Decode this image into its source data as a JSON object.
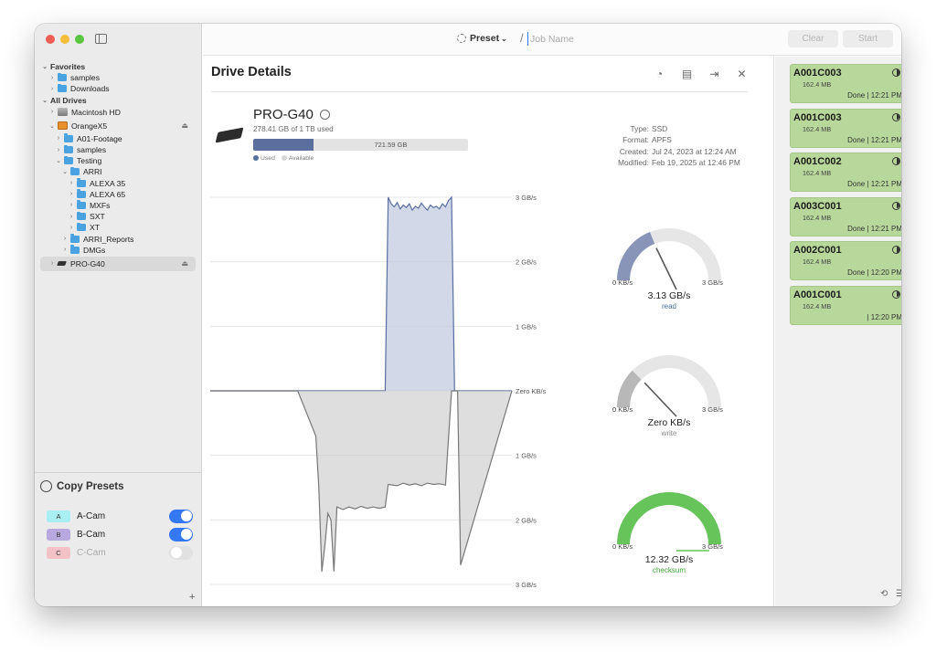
{
  "toolbar": {
    "preset_label": "Preset",
    "slash": "/",
    "job_placeholder": "Job Name",
    "clear_label": "Clear",
    "start_label": "Start"
  },
  "sidebar": {
    "favorites_label": "Favorites",
    "favorites": [
      "samples",
      "Downloads"
    ],
    "all_drives_label": "All Drives",
    "drives": {
      "macintosh": "Macintosh HD",
      "orange": "OrangeX5",
      "a01": "A01-Footage",
      "samples": "samples",
      "testing": "Testing",
      "arri": "ARRI",
      "alexa35": "ALEXA 35",
      "alexa65": "ALEXA 65",
      "mxfs": "MXFs",
      "sxt": "SXT",
      "xt": "XT",
      "arri_reports": "ARRI_Reports",
      "dmgs": "DMGs",
      "pro_g40": "PRO-G40"
    },
    "copy_presets_label": "Copy Presets",
    "presets": [
      {
        "badge": "A",
        "name": "A-Cam",
        "on": true,
        "color": "#a8eef2"
      },
      {
        "badge": "B",
        "name": "B-Cam",
        "on": true,
        "color": "#b7a9e0"
      },
      {
        "badge": "C",
        "name": "C-Cam",
        "on": false,
        "color": "#f2c2c7"
      }
    ],
    "add_label": "+"
  },
  "details": {
    "title": "Drive Details",
    "drive_name": "PRO-G40",
    "used_text": "278.41 GB of 1 TB used",
    "available_text": "721.59 GB",
    "used_fraction": 0.28,
    "legend_used": "Used",
    "legend_available": "Available",
    "props": [
      {
        "k": "Type:",
        "v": "SSD"
      },
      {
        "k": "Format:",
        "v": "APFS"
      },
      {
        "k": "Created:",
        "v": "Jul 24, 2023 at 12:24 AM"
      },
      {
        "k": "Modified:",
        "v": "Feb 19, 2025 at 12:46 PM"
      }
    ]
  },
  "chart_data": {
    "type": "area",
    "y_tick_labels": [
      "3 GB/s",
      "2 GB/s",
      "1 GB/s",
      "Zero KB/s",
      "1 GB/s",
      "2 GB/s",
      "3 GB/s"
    ],
    "ylim": [
      -3,
      3
    ],
    "series": [
      {
        "name": "read",
        "x": [
          0,
          58,
          59,
          60,
          61,
          62,
          63,
          64,
          65,
          66,
          67,
          68,
          69,
          70,
          71,
          72,
          73,
          74,
          75,
          76,
          77,
          78,
          79,
          80,
          81,
          100
        ],
        "values": [
          0,
          0,
          3.0,
          2.9,
          2.85,
          2.92,
          2.82,
          2.88,
          2.84,
          2.9,
          2.8,
          2.86,
          2.83,
          2.91,
          2.85,
          2.8,
          2.88,
          2.84,
          2.86,
          2.82,
          2.9,
          2.85,
          2.95,
          3.0,
          0,
          0
        ]
      },
      {
        "name": "write",
        "x": [
          0,
          29,
          35,
          36,
          37,
          38,
          39,
          40,
          41,
          42,
          44,
          46,
          48,
          50,
          52,
          54,
          56,
          58,
          59,
          62,
          64,
          66,
          68,
          70,
          72,
          74,
          76,
          78,
          80,
          81,
          82,
          83,
          100
        ],
        "values": [
          0,
          0,
          -0.7,
          -1.5,
          -2.8,
          -2.4,
          -1.9,
          -2.0,
          -2.8,
          -1.8,
          -1.84,
          -1.8,
          -1.83,
          -1.79,
          -1.82,
          -1.8,
          -1.82,
          -1.8,
          -1.45,
          -1.47,
          -1.43,
          -1.46,
          -1.44,
          -1.47,
          -1.43,
          -1.45,
          -1.44,
          -1.46,
          0,
          0,
          0,
          -2.7,
          0
        ]
      }
    ]
  },
  "gauges": [
    {
      "value_text": "3.13 GB/s",
      "label": "read",
      "min": "0 KB/s",
      "max": "3 GB/s",
      "fraction": 0.38,
      "color": "#8895b8",
      "label_color": "#4a6fa5"
    },
    {
      "value_text": "Zero KB/s",
      "label": "write",
      "min": "0 KB/s",
      "max": "3 GB/s",
      "fraction": 0.25,
      "color": "#b8b8b8",
      "label_color": "#888888"
    },
    {
      "value_text": "12.32 GB/s",
      "label": "checksum",
      "min": "0 KB/s",
      "max": "3 GB/s",
      "fraction": 1.0,
      "color": "#66c45a",
      "label_color": "#3fa535"
    }
  ],
  "jobs": [
    {
      "name": "A001C003",
      "size": "162.4 MB",
      "status": "Done | 12:21 PM"
    },
    {
      "name": "A001C003",
      "size": "162.4 MB",
      "status": "Done | 12:21 PM"
    },
    {
      "name": "A001C002",
      "size": "162.4 MB",
      "status": "Done | 12:21 PM"
    },
    {
      "name": "A003C001",
      "size": "162.4 MB",
      "status": "Done | 12:21 PM"
    },
    {
      "name": "A002C001",
      "size": "162.4 MB",
      "status": "Done | 12:20 PM"
    },
    {
      "name": "A001C001",
      "size": "162.4 MB",
      "status": "| 12:20 PM"
    }
  ]
}
